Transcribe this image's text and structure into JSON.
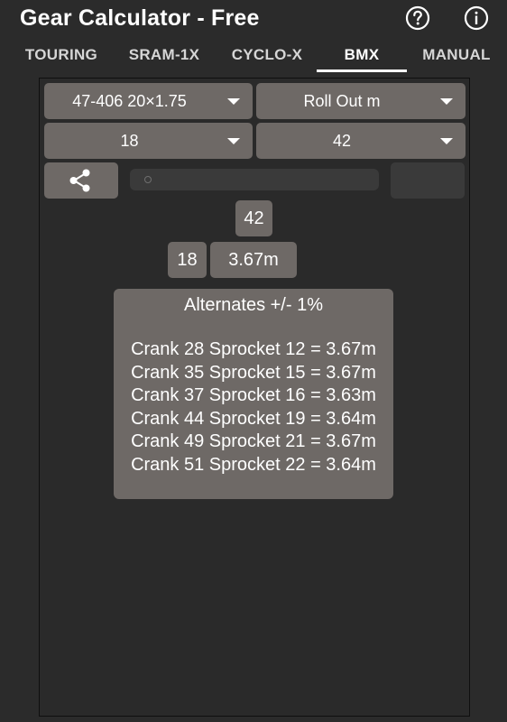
{
  "app": {
    "title": "Gear Calculator - Free"
  },
  "icons": {
    "help": "help-circle-icon",
    "info": "info-circle-icon",
    "share": "share-icon"
  },
  "tabs": [
    {
      "label": "TOURING",
      "active": false
    },
    {
      "label": "SRAM-1X",
      "active": false
    },
    {
      "label": "CYCLO-X",
      "active": false
    },
    {
      "label": "BMX",
      "active": true
    },
    {
      "label": "MANUAL",
      "active": false
    }
  ],
  "controls": {
    "tire_size": "47-406 20×1.75",
    "mode": "Roll Out m",
    "sprocket": "18",
    "crank": "42"
  },
  "slider": {
    "level": 0
  },
  "result": {
    "crank": "42",
    "sprocket": "18",
    "rollout": "3.67m"
  },
  "alternates": {
    "title": "Alternates +/- 1%",
    "items": [
      "Crank 28 Sprocket 12 = 3.67m",
      "Crank 35 Sprocket 15 = 3.67m",
      "Crank 37 Sprocket 16 = 3.63m",
      "Crank 44 Sprocket 19 = 3.64m",
      "Crank 49 Sprocket 21 = 3.67m",
      "Crank 51 Sprocket 22 = 3.64m"
    ]
  },
  "colors": {
    "background": "#2b2b2b",
    "control": "#6e6966",
    "text": "#ffffff"
  }
}
